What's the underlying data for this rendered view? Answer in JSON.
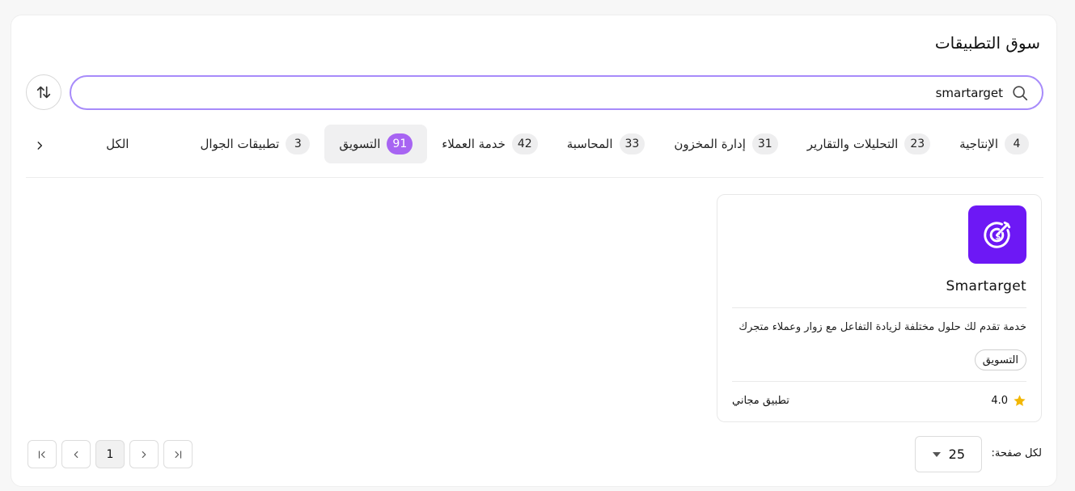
{
  "page": {
    "title": "سوق التطبيقات"
  },
  "search": {
    "value": "smartarget",
    "placeholder": ""
  },
  "tabs": [
    {
      "label": "الكل",
      "count": ""
    },
    {
      "label": "تطبيقات الجوال",
      "count": "3"
    },
    {
      "label": "التسويق",
      "count": "91"
    },
    {
      "label": "خدمة العملاء",
      "count": "42"
    },
    {
      "label": "المحاسبة",
      "count": "33"
    },
    {
      "label": "إدارة المخزون",
      "count": "31"
    },
    {
      "label": "التحليلات والتقارير",
      "count": "23"
    },
    {
      "label": "الإنتاجية",
      "count": "4"
    }
  ],
  "active_tab": "التسويق",
  "app_card": {
    "name": "Smartarget",
    "description": "خدمة تقدم لك حلول مختلفة لزيادة التفاعل مع زوار وعملاء متجرك",
    "tag": "التسويق",
    "rating": "4.0",
    "price": "تطبيق مجاني",
    "logo_color": "#6d18f5"
  },
  "pagination": {
    "per_page_label": "لكل صفحة:",
    "per_page_value": "25",
    "current_page": "1"
  },
  "colors": {
    "accent": "#a764f2",
    "search_border": "#a78bfa",
    "star": "#f2b705"
  },
  "icons": [
    "sort-icon",
    "search-icon",
    "chevron-right-icon",
    "star-icon",
    "chevron-down-icon",
    "first-page-icon",
    "prev-page-icon",
    "next-page-icon",
    "last-page-icon"
  ]
}
